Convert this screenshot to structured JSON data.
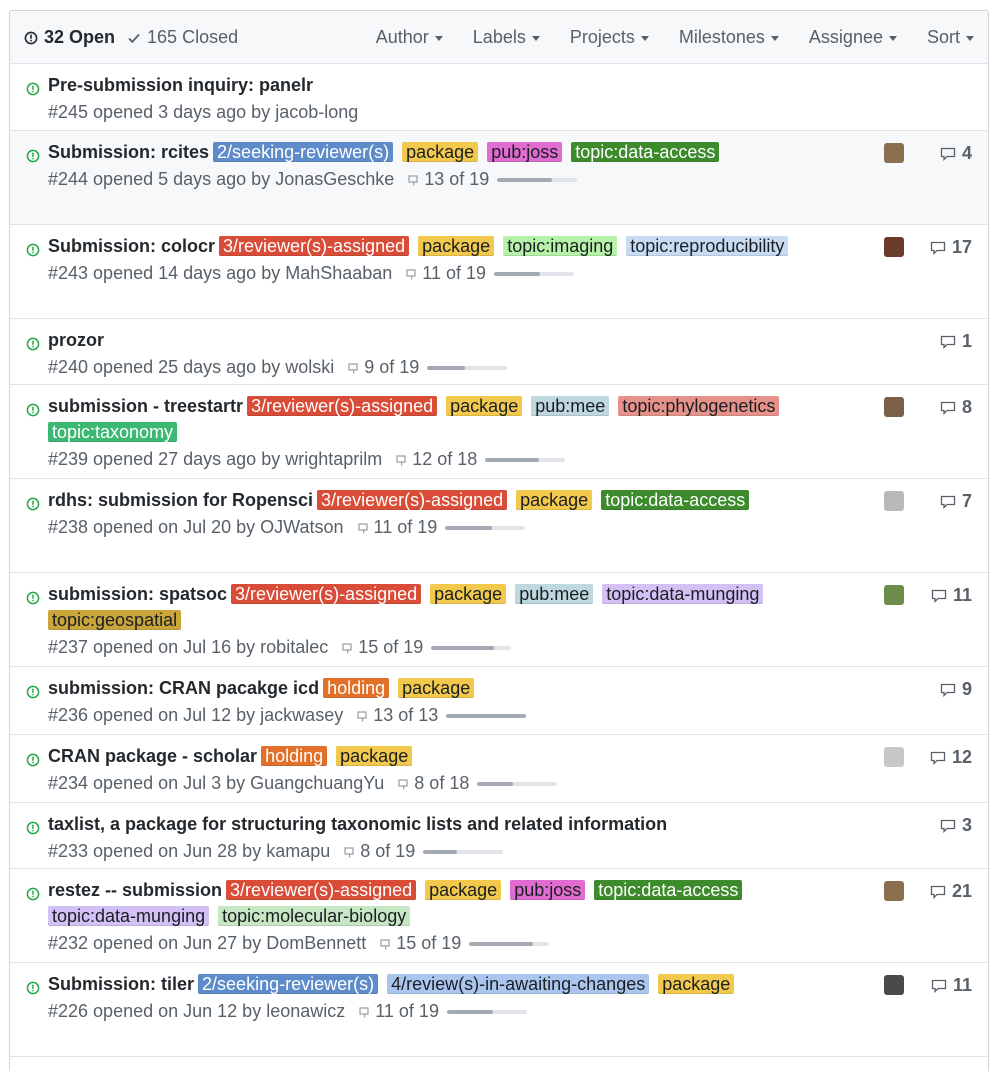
{
  "header": {
    "open_label": "32 Open",
    "closed_label": "165 Closed",
    "filters": [
      "Author",
      "Labels",
      "Projects",
      "Milestones",
      "Assignee",
      "Sort"
    ]
  },
  "colors": {
    "open_icon": "#28a745",
    "labels": {
      "2/seeking-reviewer(s)": "#5e8bc9",
      "3/reviewer(s)-assigned": "#d84c38",
      "4/review(s)-in-awaiting-changes": "#aac6ee",
      "package": "#f2c94c",
      "pub:joss": "#e06bd1",
      "pub:mee": "#bfd7de",
      "topic:data-access": "#3d8b2d",
      "topic:imaging": "#b6f2a8",
      "topic:reproducibility": "#c7dbf3",
      "topic:phylogenetics": "#e6928a",
      "topic:taxonomy": "#3cb873",
      "topic:data-munging": "#d3c1f6",
      "topic:geospatial": "#c9a53a",
      "topic:molecular-biology": "#c7e6c3",
      "holding": "#e0702a"
    }
  },
  "issues": [
    {
      "title": "Pre-submission inquiry: panelr",
      "labels": [],
      "meta": "#245 opened 3 days ago by jacob-long",
      "milestone": "",
      "progress": null,
      "comments": "",
      "avatar": false
    },
    {
      "title": "Submission: rcites",
      "labels": [
        "2/seeking-reviewer(s)",
        "package",
        "pub:joss",
        "topic:data-access"
      ],
      "meta": "#244 opened 5 days ago by JonasGeschke",
      "milestone": "13 of 19",
      "progress": 0.68,
      "comments": "4",
      "avatar": true
    },
    {
      "title": "Submission: colocr",
      "labels": [
        "3/reviewer(s)-assigned",
        "package",
        "topic:imaging",
        "topic:reproducibility"
      ],
      "meta": "#243 opened 14 days ago by MahShaaban",
      "milestone": "11 of 19",
      "progress": 0.58,
      "comments": "17",
      "avatar": true
    },
    {
      "title": "prozor",
      "labels": [],
      "meta": "#240 opened 25 days ago by wolski",
      "milestone": "9 of 19",
      "progress": 0.47,
      "comments": "1",
      "avatar": false
    },
    {
      "title": "submission - treestartr",
      "labels": [
        "3/reviewer(s)-assigned",
        "package",
        "pub:mee",
        "topic:phylogenetics",
        "topic:taxonomy"
      ],
      "meta": "#239 opened 27 days ago by wrightaprilm",
      "milestone": "12 of 18",
      "progress": 0.67,
      "comments": "8",
      "avatar": true
    },
    {
      "title": "rdhs: submission for Ropensci",
      "labels": [
        "3/reviewer(s)-assigned",
        "package",
        "topic:data-access"
      ],
      "meta": "#238 opened on Jul 20 by OJWatson",
      "milestone": "11 of 19",
      "progress": 0.58,
      "comments": "7",
      "avatar": true
    },
    {
      "title": "submission: spatsoc",
      "labels": [
        "3/reviewer(s)-assigned",
        "package",
        "pub:mee",
        "topic:data-munging",
        "topic:geospatial"
      ],
      "meta": "#237 opened on Jul 16 by robitalec",
      "milestone": "15 of 19",
      "progress": 0.79,
      "comments": "11",
      "avatar": true
    },
    {
      "title": "submission: CRAN pacakge icd",
      "labels": [
        "holding",
        "package"
      ],
      "meta": "#236 opened on Jul 12 by jackwasey",
      "milestone": "13 of 13",
      "progress": 1.0,
      "comments": "9",
      "avatar": false
    },
    {
      "title": "CRAN package - scholar",
      "labels": [
        "holding",
        "package"
      ],
      "meta": "#234 opened on Jul 3 by GuangchuangYu",
      "milestone": "8 of 18",
      "progress": 0.44,
      "comments": "12",
      "avatar": true
    },
    {
      "title": "taxlist, a package for structuring taxonomic lists and related information",
      "labels": [],
      "meta": "#233 opened on Jun 28 by kamapu",
      "milestone": "8 of 19",
      "progress": 0.42,
      "comments": "3",
      "avatar": false
    },
    {
      "title": "restez -- submission",
      "labels": [
        "3/reviewer(s)-assigned",
        "package",
        "pub:joss",
        "topic:data-access",
        "topic:data-munging",
        "topic:molecular-biology"
      ],
      "meta": "#232 opened on Jun 27 by DomBennett",
      "milestone": "15 of 19",
      "progress": 0.79,
      "comments": "21",
      "avatar": true
    },
    {
      "title": "Submission: tiler",
      "labels": [
        "2/seeking-reviewer(s)",
        "4/review(s)-in-awaiting-changes",
        "package"
      ],
      "meta": "#226 opened on Jun 12 by leonawicz",
      "milestone": "11 of 19",
      "progress": 0.58,
      "comments": "11",
      "avatar": true
    }
  ]
}
